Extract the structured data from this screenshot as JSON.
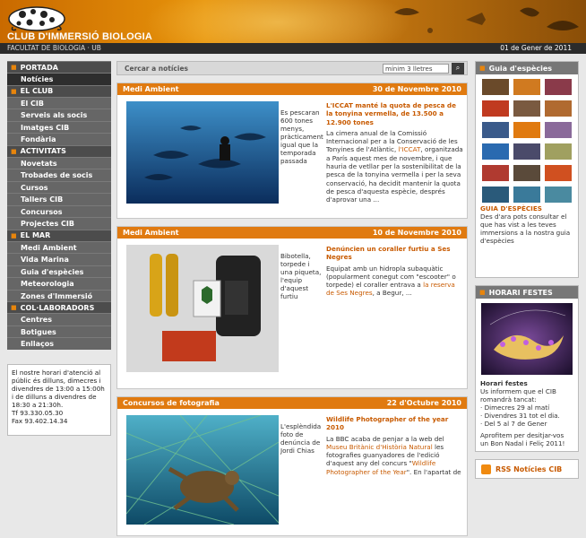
{
  "header": {
    "title": "CLUB D'IMMERSIÓ BIOLOGIA",
    "faculty": "FACULTAT DE BIOLOGIA · UB",
    "date": "01 de Gener de 2011"
  },
  "nav": {
    "sections": [
      {
        "label": "PORTADA",
        "items": [
          "Notícies"
        ]
      },
      {
        "label": "EL CLUB",
        "items": [
          "El CIB",
          "Serveis als socis",
          "Imatges CIB",
          "Fondària"
        ]
      },
      {
        "label": "ACTIVITATS",
        "items": [
          "Novetats",
          "Trobades de socis",
          "Cursos",
          "Tallers CIB",
          "Concursos",
          "Projectes CIB"
        ]
      },
      {
        "label": "EL MAR",
        "items": [
          "Medi Ambient",
          "Vida Marina",
          "Guia d'espècies",
          "Meteorologia",
          "Zones d'Immersió"
        ]
      },
      {
        "label": "COL·LABORADORS",
        "items": [
          "Centres",
          "Botigues",
          "Enllaços"
        ]
      }
    ],
    "info": "El nostre horari d'atenció al públic és dilluns, dimecres i divendres de 13:00 a 15:00h i de dilluns a divendres de 18:30 a 21:30h.",
    "phone": "Tf 93.330.05.30",
    "fax": "Fax 93.402.14.34"
  },
  "search": {
    "label": "Cercar a notícies",
    "placeholder": "mínim 3 lletres",
    "go": "⌕"
  },
  "news": [
    {
      "category": "Medi Ambient",
      "date": "30 de Novembre 2010",
      "caption": "Es pescaran 600 tones menys, pràcticament igual que la temporada passada",
      "title": "L'ICCAT manté la quota de pesca de la tonyina vermella, de 13.500 a 12.900 tones",
      "body_1": "La cimera anual de la Comissió Internacional per a la Conservació de les Tonyines de l'Atlàntic, ",
      "link": "l'ICCAT",
      "body_2": ", organitzada a París aquest mes de novembre, i que hauria de vetllar per la sostenibilitat de la pesca de la tonyina vermella i per la seva conservació, ha decidit mantenir la quota de pesca d'aquesta espècie, després d'aprovar una ..."
    },
    {
      "category": "Medi Ambient",
      "date": "10 de Novembre 2010",
      "caption": "Bibotella, torpede i una piqueta, l'equip d'aquest furtiu",
      "title": "Denúncien un coraller furtiu a Ses Negres",
      "body_1": "Equipat amb un hidropla subaquàtic (popularment conegut com \"escooter\" o torpede) el coraller entrava a ",
      "link": "la reserva de Ses Negres",
      "body_2": ", a Begur, ..."
    },
    {
      "category": "Concursos de fotografia",
      "date": "22 d'Octubre 2010",
      "caption": "L'esplèndida foto de denúncia de Jordi Chias",
      "title": "Wildlife Photographer of the year 2010",
      "body_1": "La BBC acaba de penjar a la web del ",
      "link": "Museu Britànic d'Història Natural",
      "body_2": " les fotografies guanyadores de l'edició d'aquest any del concurs \"",
      "link_2": "Wildlife Photographer of the Year",
      "body_3": "\". En l'apartat de"
    }
  ],
  "guia": {
    "heading": "Guia d'espècies",
    "title": "GUIA D'ESPÈCIES",
    "text": "Des d'ara pots consultar el que has vist a les teves immersions a la nostra guia d'espècies"
  },
  "horari": {
    "heading": "HORARI FESTES",
    "title": "Horari festes",
    "intro": "Us informem que el CIB romandrà tancat:",
    "lines": [
      "· Dimecres 29 al matí",
      "· Divendres 31 tot el dia.",
      "· Del 5 al 7 de Gener"
    ],
    "wish": "Aprofitem per desitjar-vos un Bon Nadal i Feliç 2011!"
  },
  "rss": {
    "label": "RSS Notícies CIB"
  },
  "colors": {
    "accent": "#e07a10",
    "link": "#c85a00",
    "nav_bg": "#666666"
  }
}
